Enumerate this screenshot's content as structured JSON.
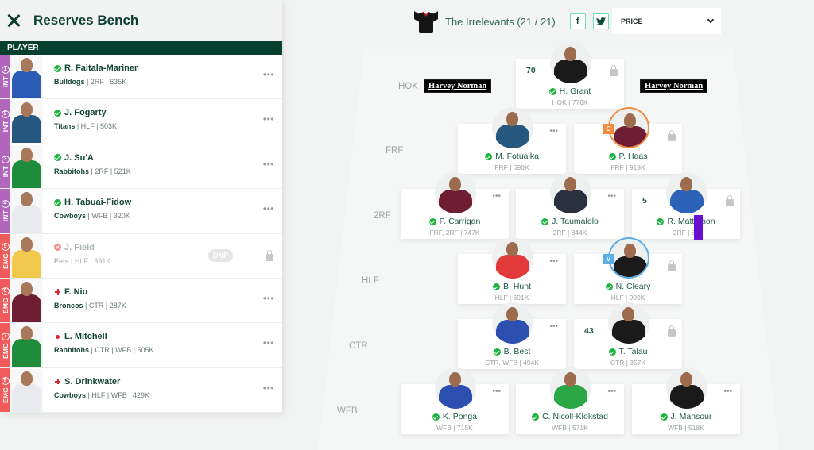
{
  "sidebar": {
    "title": "Reserves Bench",
    "column_header": "PLAYER",
    "players": [
      {
        "slot_type": "INT",
        "slot_num": "1",
        "name": "R. Faitala-Mariner",
        "team": "Bulldogs",
        "meta": " | 2RF | 635K",
        "status": "ok",
        "action": "dots",
        "jersey": "#2a5bb5"
      },
      {
        "slot_type": "INT",
        "slot_num": "2",
        "name": "J. Fogarty",
        "team": "Titans",
        "meta": " | HLF | 503K",
        "status": "ok",
        "action": "dots",
        "jersey": "#25577f"
      },
      {
        "slot_type": "INT",
        "slot_num": "3",
        "name": "J. Su'A",
        "team": "Rabbitohs",
        "meta": " | 2RF | 521K",
        "status": "ok",
        "action": "dots",
        "jersey": "#1e8c3a"
      },
      {
        "slot_type": "INT",
        "slot_num": "4",
        "name": "H. Tabuai-Fidow",
        "team": "Cowboys",
        "meta": " | WFB | 320K",
        "status": "ok",
        "action": "dots",
        "jersey": "#e8eaee"
      },
      {
        "slot_type": "EMG",
        "slot_num": "5",
        "name": "J. Field",
        "team": "Eels",
        "meta": " | HLF | 391K",
        "status": "out",
        "action": "lock",
        "badge": "DNP",
        "jersey": "#f2c94c"
      },
      {
        "slot_type": "EMG",
        "slot_num": "6",
        "name": "F. Niu",
        "team": "Broncos",
        "meta": " | CTR | 287K",
        "status": "cross",
        "action": "dots",
        "jersey": "#6e1d35"
      },
      {
        "slot_type": "EMG",
        "slot_num": "7",
        "name": "L. Mitchell",
        "team": "Rabbitohs",
        "meta": " | CTR | WFB | 505K",
        "status": "dot",
        "action": "dots",
        "jersey": "#1e8c3a"
      },
      {
        "slot_type": "EMG",
        "slot_num": "8",
        "name": "S. Drinkwater",
        "team": "Cowboys",
        "meta": " | HLF | WFB | 429K",
        "status": "cross",
        "action": "dots",
        "jersey": "#e8eaee"
      }
    ]
  },
  "header": {
    "team_name": "The Irrelevants (21 / 21)",
    "facebook_label": "f",
    "twitter_icon": "twitter-bird-icon",
    "sort_value": "PRICE"
  },
  "field": {
    "sponsor": "Harvey Norman",
    "position_labels": [
      "HOK",
      "FRF",
      "2RF",
      "HLF",
      "CTR",
      "WFB"
    ],
    "cards": [
      {
        "name": "H. Grant",
        "meta": "HOK | 776K",
        "score": "70",
        "action": "lock",
        "role": "",
        "jersey": "#1a1a1a"
      },
      {
        "name": "M. Fotuaika",
        "meta": "FRF | 690K",
        "score": "",
        "action": "dots",
        "role": "",
        "jersey": "#25577f"
      },
      {
        "name": "P. Haas",
        "meta": "FRF | 919K",
        "score": "",
        "action": "lock",
        "role": "C",
        "jersey": "#6e1d35"
      },
      {
        "name": "P. Carrigan",
        "meta": "FRF, 2RF | 747K",
        "score": "",
        "action": "dots",
        "role": "",
        "jersey": "#6e1d35"
      },
      {
        "name": "J. Taumalolo",
        "meta": "2RF | 844K",
        "score": "",
        "action": "dots",
        "role": "",
        "jersey": "#2a3040"
      },
      {
        "name": "R. Matterson",
        "meta": "2RF | 88",
        "score": "5",
        "action": "lock",
        "role": "",
        "jersey": "#2c63b8"
      },
      {
        "name": "B. Hunt",
        "meta": "HLF | 691K",
        "score": "",
        "action": "dots",
        "role": "",
        "jersey": "#e23a3a"
      },
      {
        "name": "N. Cleary",
        "meta": "HLF | 909K",
        "score": "",
        "action": "lock",
        "role": "V",
        "jersey": "#1a1a1a"
      },
      {
        "name": "B. Best",
        "meta": "CTR, WFB | 494K",
        "score": "",
        "action": "dots",
        "role": "",
        "jersey": "#2c4fb0"
      },
      {
        "name": "T. Talau",
        "meta": "CTR | 357K",
        "score": "43",
        "action": "lock",
        "role": "",
        "jersey": "#1a1a1a"
      },
      {
        "name": "K. Ponga",
        "meta": "WFB | 715K",
        "score": "",
        "action": "dots",
        "role": "",
        "jersey": "#2c4fb0"
      },
      {
        "name": "C. Nicoll-Klokstad",
        "meta": "WFB | 571K",
        "score": "",
        "action": "dots",
        "role": "",
        "jersey": "#29a845"
      },
      {
        "name": "J. Mansour",
        "meta": "WFB | 518K",
        "score": "",
        "action": "dots",
        "role": "",
        "jersey": "#1a1a1a"
      }
    ]
  },
  "colors": {
    "brand_dark": "#073f2f",
    "int_tag": "#b066bb",
    "emg_tag": "#f05a5a",
    "captain": "#f58b3c",
    "vice": "#5aaee6",
    "status_ok": "#1bb53c"
  }
}
